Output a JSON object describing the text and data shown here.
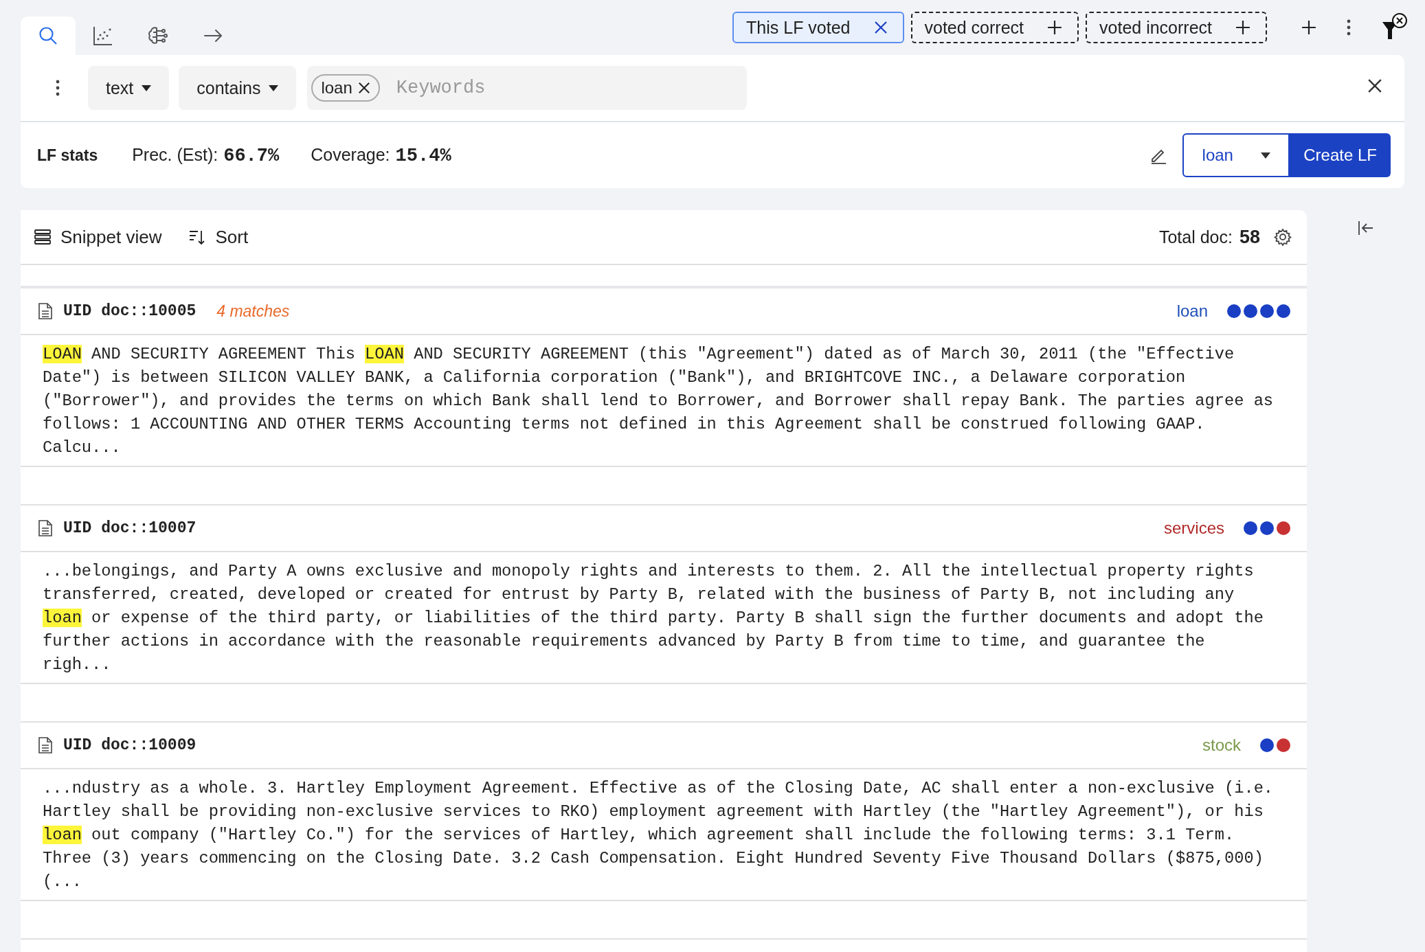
{
  "nav_tabs": [
    {
      "kind": "search",
      "selected": true
    },
    {
      "kind": "scatter",
      "selected": false
    },
    {
      "kind": "brain",
      "selected": false
    },
    {
      "kind": "arrow",
      "selected": false
    }
  ],
  "filter_chips": [
    {
      "label": "This LF voted",
      "kind": "active"
    },
    {
      "label": "voted correct",
      "kind": "dashed"
    },
    {
      "label": "voted incorrect",
      "kind": "dashed"
    }
  ],
  "search": {
    "field": "text",
    "operator": "contains",
    "tags": [
      "loan"
    ],
    "placeholder": "Keywords"
  },
  "lf_stats": {
    "title": "LF stats",
    "precision_label": "Prec. (Est):",
    "precision": "66.7%",
    "coverage_label": "Coverage:",
    "coverage": "15.4%"
  },
  "lf_label": "loan",
  "create_button": "Create LF",
  "results": {
    "view": "Snippet view",
    "sort": "Sort",
    "total_label": "Total doc:",
    "total": "58"
  },
  "docs": [
    {
      "uid": "UID doc::10005",
      "matches": "4 matches",
      "label": "loan",
      "color": "#1f4fb8",
      "votes": [
        {
          "color": "#1a3fc4"
        },
        {
          "color": "#1a3fc4"
        },
        {
          "color": "#1a3fc4"
        },
        {
          "color": "#1a3fc4"
        }
      ],
      "snippet": [
        {
          "text": "LOAN",
          "highlight": true
        },
        {
          "text": " AND SECURITY AGREEMENT This ",
          "highlight": false
        },
        {
          "text": "LOAN",
          "highlight": true
        },
        {
          "text": " AND SECURITY AGREEMENT (this \"Agreement\") dated as of March 30, 2011 (the \"Effective Date\") is between SILICON VALLEY BANK, a California corporation (\"Bank\"), and BRIGHTCOVE INC., a Delaware corporation (\"Borrower\"), and provides the terms on which Bank shall lend to Borrower, and Borrower shall repay Bank. The parties agree as follows: 1 ACCOUNTING AND OTHER TERMS Accounting terms not defined in this Agreement shall be construed following GAAP. Calcu...",
          "highlight": false
        }
      ]
    },
    {
      "uid": "UID doc::10007",
      "label": "services",
      "color": "#b02a2a",
      "votes": [
        {
          "color": "#1a3fc4"
        },
        {
          "color": "#1a3fc4"
        },
        {
          "color": "#c83232"
        }
      ],
      "snippet": [
        {
          "text": "...belongings, and Party A owns exclusive and monopoly rights and interests to them. 2. All the intellectual property rights transferred, created, developed or created for entrust by Party B, related with the business of Party B, not including any ",
          "highlight": false
        },
        {
          "text": "loan",
          "highlight": true
        },
        {
          "text": " or expense of the third party, or liabilities of the third party. Party B shall sign the further documents and adopt the further actions in accordance with the reasonable requirements advanced by Party B from time to time, and guarantee the righ...",
          "highlight": false
        }
      ]
    },
    {
      "uid": "UID doc::10009",
      "label": "stock",
      "color": "#7a9a4a",
      "votes": [
        {
          "color": "#1a3fc4"
        },
        {
          "color": "#c83232"
        }
      ],
      "snippet": [
        {
          "text": "...ndustry as a whole. 3. Hartley Employment Agreement. Effective as of the Closing Date, AC shall enter a non-exclusive (i.e. Hartley shall be providing non-exclusive services to RKO) employment agreement with Hartley (the \"Hartley Agreement\"), or his ",
          "highlight": false
        },
        {
          "text": "loan",
          "highlight": true
        },
        {
          "text": " out company (\"Hartley Co.\") for the services of Hartley, which agreement shall include the following terms: 3.1 Term. Three (3) years commencing on the Closing Date. 3.2 Cash Compensation. Eight Hundred Seventy Five Thousand Dollars ($875,000) (...",
          "highlight": false
        }
      ]
    }
  ]
}
